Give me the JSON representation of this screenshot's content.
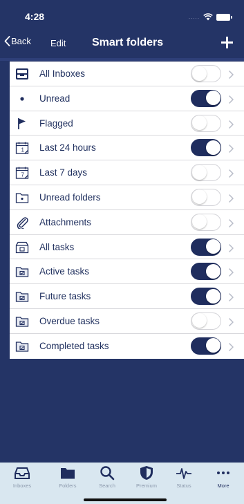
{
  "status_bar": {
    "time": "4:28",
    "signal": "....."
  },
  "nav": {
    "back_label": "Back",
    "edit_label": "Edit",
    "title": "Smart folders",
    "add_icon": "plus-icon"
  },
  "rows": [
    {
      "label": "All Inboxes",
      "icon": "inbox-tray-icon",
      "enabled": false
    },
    {
      "label": "Unread",
      "icon": "dot-icon",
      "enabled": true
    },
    {
      "label": "Flagged",
      "icon": "flag-icon",
      "enabled": false
    },
    {
      "label": "Last 24 hours",
      "icon": "calendar-icon",
      "icon_text": "1",
      "enabled": true
    },
    {
      "label": "Last 7 days",
      "icon": "calendar-icon",
      "icon_text": "7",
      "enabled": false
    },
    {
      "label": "Unread folders",
      "icon": "folder-dot-icon",
      "enabled": false
    },
    {
      "label": "Attachments",
      "icon": "paperclip-icon",
      "enabled": false
    },
    {
      "label": "All tasks",
      "icon": "task-box-icon",
      "enabled": true
    },
    {
      "label": "Active tasks",
      "icon": "task-folder-icon",
      "enabled": true
    },
    {
      "label": "Future tasks",
      "icon": "task-folder-icon",
      "enabled": true
    },
    {
      "label": "Overdue tasks",
      "icon": "task-folder-icon",
      "enabled": false
    },
    {
      "label": "Completed tasks",
      "icon": "task-folder-icon",
      "enabled": true
    }
  ],
  "tabs": [
    {
      "label": "Inboxes",
      "icon": "inbox-icon",
      "active": false
    },
    {
      "label": "Folders",
      "icon": "folder-icon",
      "active": false
    },
    {
      "label": "Search",
      "icon": "search-icon",
      "active": false
    },
    {
      "label": "Premium",
      "icon": "shield-icon",
      "active": false
    },
    {
      "label": "Status",
      "icon": "pulse-icon",
      "active": false
    },
    {
      "label": "More",
      "icon": "more-icon",
      "active": true
    }
  ],
  "colors": {
    "navy": "#243466",
    "toggle_on": "#1f2d5e",
    "tab_bar": "#d9e7f0"
  }
}
